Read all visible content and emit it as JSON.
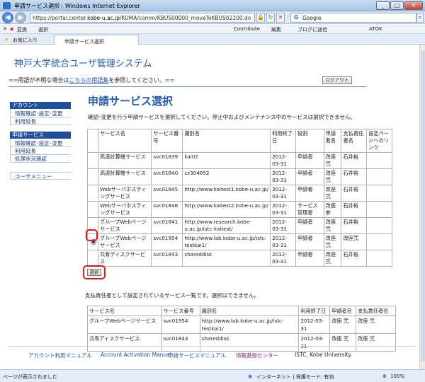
{
  "window": {
    "title": "申請サービス選択 - Windows Internet Explorer"
  },
  "address": {
    "url_prefix": "https://portal.center.",
    "url_domain": "kobe-u.ac.jp",
    "url_path": "/KUMA/comm/KBUS00000_moveToKBUS02200.do",
    "search_engine": "Google"
  },
  "toolbar1": {
    "convert": "変換",
    "select": "選択",
    "contribute": "Contribute",
    "edit": "編集",
    "blog": "ブログに送信",
    "atok": "ATOK"
  },
  "toolbar2": {
    "favorites": "お気に入り",
    "tab_label": "申請サービス選択"
  },
  "header": {
    "system_name": "神戸大学統合ユーザ管理システム",
    "term_prefix": "==用語が不明な場合は",
    "term_link": "こちらの用語集",
    "term_suffix": "を参照してください。==",
    "logout": "ログアウト"
  },
  "sidebar": {
    "account_header": "アカウント",
    "account_items": [
      "情報確認･設定･変更",
      "利用延長"
    ],
    "service_header": "申請サービス",
    "service_items": [
      "情報確認･設定･変更",
      "利用延長",
      "処理状況確認"
    ],
    "user_menu": "ユーザメニュー"
  },
  "main": {
    "heading": "申請サービス選択",
    "description": "確認･変更を行う申請サービスを選択してください。停止中およびメンテナンス中のサービスは選択できません。",
    "columns": [
      "サービス名",
      "サービス番号",
      "識別名",
      "利用終了日",
      "役割",
      "申請者名",
      "支払責任者名",
      "設定ページへのリンク"
    ],
    "rows": [
      {
        "name": "高速計算機サービス",
        "no": "svc01839",
        "id": "kai02",
        "end": "2012-03-31",
        "role": "申請者",
        "applicant": "改座弐",
        "payer": "石井裕",
        "link": ""
      },
      {
        "name": "高速計算機サービス",
        "no": "svc01840",
        "id": "cz304852",
        "end": "2012-03-31",
        "role": "申請者",
        "applicant": "改座弐",
        "payer": "石井裕",
        "link": ""
      },
      {
        "name": "Webサーバホスティングサービス",
        "no": "svc01845",
        "id": "http://www.kaitest1.kobe-u.ac.jp/",
        "end": "2012-03-31",
        "role": "申請者",
        "applicant": "改座弐",
        "payer": "石井裕",
        "link": ""
      },
      {
        "name": "Webサーバホスティングサービス",
        "no": "svc01846",
        "id": "http://www.kaitest2.kobe-u.ac.jp/",
        "end": "2012-03-31",
        "role": "サービス管理者",
        "applicant": "改座参",
        "payer": "石井裕",
        "link": ""
      },
      {
        "name": "グループWebページサービス",
        "no": "svc01841",
        "id": "http://www.research.kobe-u.ac.jp/istc-kaitest/",
        "end": "2012-03-31",
        "role": "申請者",
        "applicant": "改座弐",
        "payer": "石井裕",
        "link": ""
      },
      {
        "name": "グループWebページサービス",
        "no": "svc01954",
        "id": "http://www.lab.kobe-u.ac.jp/istc-testkai1/",
        "end": "2012-03-31",
        "role": "申請者",
        "applicant": "改座弐",
        "payer": "改座弐",
        "link": ""
      },
      {
        "name": "共有ディスクサービス",
        "no": "svc01843",
        "id": "shareddisk",
        "end": "2012-03-31",
        "role": "申請者",
        "applicant": "改座弐",
        "payer": "石井裕",
        "link": ""
      }
    ],
    "select_button": "選択",
    "payer_description": "支払責任者として設定されているサービス一覧です。選択はできません。",
    "payer_columns": [
      "サービス名",
      "サービス番号",
      "識別名",
      "利用終了日",
      "申請者名",
      "支払責任者名"
    ],
    "payer_rows": [
      {
        "name": "グループWebページサービス",
        "no": "svc01954",
        "id": "http://www.lab.kobe-u.ac.jp/istc-testkai1/",
        "end": "2012-03-31",
        "applicant": "改座 弐",
        "payer": "改座 弐"
      },
      {
        "name": "共有ディスクサービス",
        "no": "svc01843",
        "id": "shareddisk",
        "end": "2012-03-31",
        "applicant": "改座 弐",
        "payer": "改座 弐"
      }
    ]
  },
  "footer": {
    "links": [
      "アカウント利用マニュアル",
      "Account Activation Manual",
      "申請サービスマニュアル",
      "情報基盤センター"
    ],
    "copyright": "ISTC, Kobe University."
  },
  "status": {
    "left": "ページが表示されました",
    "zone": "インターネット | 保護モード: 有効",
    "zoom": "100%"
  }
}
